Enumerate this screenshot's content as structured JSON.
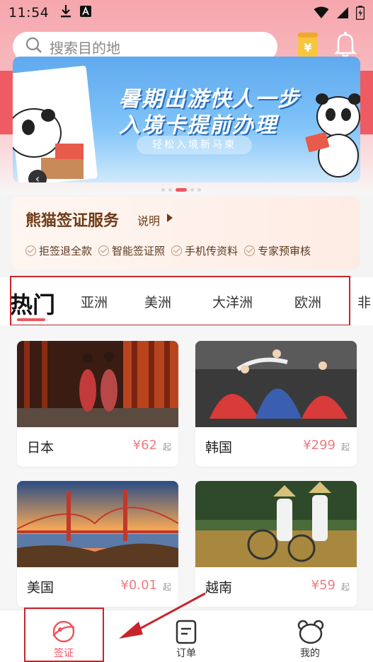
{
  "status_bar": {
    "time": "11:54"
  },
  "search": {
    "placeholder": "搜索目的地"
  },
  "banner": {
    "title_line1": "暑期出游快人一步",
    "title_line2": "入境卡提前办理",
    "subtitle": "轻松入境新马柬",
    "carousel_dots": 5,
    "active_dot": 2
  },
  "service": {
    "title": "熊猫签证服务",
    "explain_label": "说明",
    "features": [
      "拒签退全款",
      "智能签证照",
      "手机传资料",
      "专家预审核"
    ]
  },
  "tabs": [
    "热门",
    "亚洲",
    "美洲",
    "大洋洲",
    "欧洲",
    "非"
  ],
  "destinations": [
    {
      "name": "日本",
      "price": "¥62",
      "suffix": "起"
    },
    {
      "name": "韩国",
      "price": "¥299",
      "suffix": "起"
    },
    {
      "name": "美国",
      "price": "¥0.01",
      "suffix": "起"
    },
    {
      "name": "越南",
      "price": "¥59",
      "suffix": "起"
    }
  ],
  "bottom_nav": [
    {
      "label": "签证",
      "active": true
    },
    {
      "label": "订单",
      "active": false
    },
    {
      "label": "我的",
      "active": false
    }
  ],
  "colors": {
    "accent": "#f05560",
    "price": "#f07b82",
    "brand_brown": "#6e3b17",
    "annotation": "#c8232c"
  }
}
